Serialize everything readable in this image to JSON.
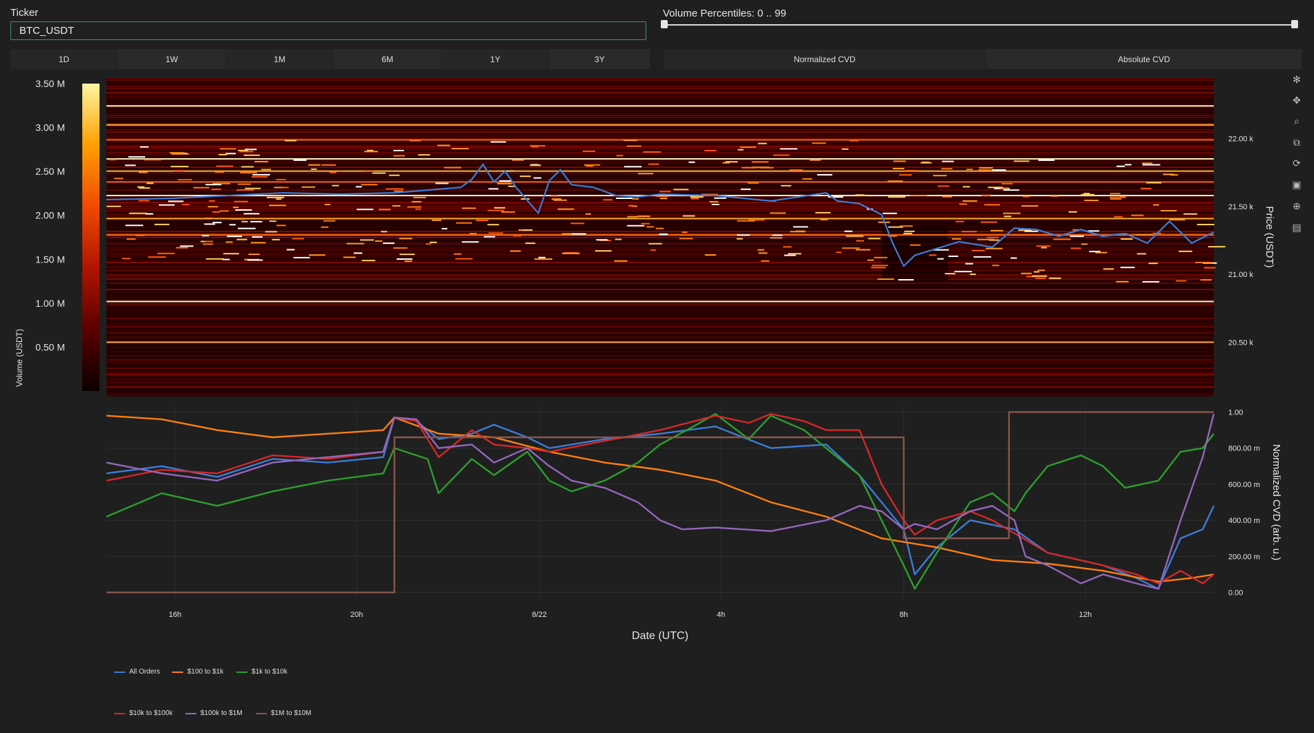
{
  "controls": {
    "ticker_label": "Ticker",
    "ticker_value": "BTC_USDT",
    "volume_percentiles_label": "Volume Percentiles: 0 .. 99",
    "volume_percentile_min": 0,
    "volume_percentile_max": 99,
    "timeframe_tabs": [
      "1D",
      "1W",
      "1M",
      "6M",
      "1Y",
      "3Y"
    ],
    "cvd_tabs": [
      "Normalized CVD",
      "Absolute CVD"
    ]
  },
  "modebar_icons": [
    "plotly-logo-icon",
    "pan-icon",
    "zoom-icon",
    "zoom-box-icon",
    "reset-icon",
    "save-icon",
    "crosshair-icon",
    "comment-icon"
  ],
  "chart_data": [
    {
      "type": "heatmap",
      "colorbar": {
        "title": "Volume (USDT)",
        "ticks": [
          "3.50 M",
          "3.00 M",
          "2.50 M",
          "2.00 M",
          "1.50 M",
          "1.00 M",
          "0.50 M"
        ],
        "tick_values": [
          3.5,
          3.0,
          2.5,
          2.0,
          1.5,
          1.0,
          0.5
        ],
        "range": [
          0,
          3.5
        ],
        "colorscale": [
          "#0a0000",
          "#5a0000",
          "#b01400",
          "#f04a00",
          "#ffa000",
          "#fff5a0"
        ]
      },
      "ylabel": "Price (USDT)",
      "y_ticks": [
        "22.00 k",
        "21.50 k",
        "21.00 k",
        "20.50 k"
      ],
      "y_tick_values": [
        22000,
        21500,
        21000,
        20500
      ],
      "ylim": [
        20100,
        22450
      ],
      "bright_levels": [
        22240,
        22100,
        21990,
        21850,
        21760,
        21680,
        21580,
        21410,
        21290,
        20800,
        20500
      ],
      "price_line": {
        "color": "#3b7dd8",
        "x": [
          0,
          6,
          11,
          16,
          21,
          26,
          32,
          33,
          34,
          35,
          36,
          37,
          39,
          40,
          41,
          42,
          44,
          46,
          48,
          50,
          55,
          60,
          65,
          66,
          68,
          70,
          71,
          72,
          73,
          75,
          77,
          80,
          82,
          84,
          86,
          88,
          90,
          92,
          94,
          96,
          98,
          100
        ],
        "y": [
          21550,
          21560,
          21580,
          21600,
          21590,
          21600,
          21640,
          21700,
          21810,
          21680,
          21760,
          21640,
          21450,
          21690,
          21770,
          21660,
          21640,
          21580,
          21570,
          21590,
          21580,
          21540,
          21600,
          21540,
          21520,
          21440,
          21230,
          21060,
          21140,
          21190,
          21240,
          21200,
          21340,
          21330,
          21280,
          21330,
          21280,
          21300,
          21230,
          21390,
          21230,
          21310
        ]
      },
      "x_ticks": [
        "16h",
        "20h",
        "8/22",
        "4h",
        "8h",
        "12h"
      ],
      "x_tick_positions": [
        6.2,
        22.6,
        39.1,
        55.5,
        72.0,
        88.4
      ]
    },
    {
      "type": "line",
      "xlabel": "Date (UTC)",
      "ylabel": "Normalized CVD (arb. u.)",
      "y_ticks": [
        "1.00",
        "800.00 m",
        "600.00 m",
        "400.00 m",
        "200.00 m",
        "0.00"
      ],
      "y_tick_values": [
        1.0,
        0.8,
        0.6,
        0.4,
        0.2,
        0.0
      ],
      "ylim": [
        -0.04,
        1.04
      ],
      "x_ticks": [
        "16h",
        "20h",
        "8/22",
        "4h",
        "8h",
        "12h"
      ],
      "x_tick_positions": [
        6.2,
        22.6,
        39.1,
        55.5,
        72.0,
        88.4
      ],
      "series": [
        {
          "name": "All Orders",
          "color": "#3b7dd8",
          "x": [
            0,
            5,
            10,
            15,
            20,
            25,
            26,
            28,
            30,
            33,
            35,
            38,
            40,
            45,
            50,
            55,
            60,
            65,
            68,
            70,
            72,
            73,
            75,
            78,
            82,
            85,
            90,
            93,
            95,
            97,
            99,
            100
          ],
          "y": [
            0.66,
            0.7,
            0.64,
            0.74,
            0.72,
            0.75,
            0.97,
            0.95,
            0.85,
            0.88,
            0.93,
            0.86,
            0.8,
            0.85,
            0.88,
            0.92,
            0.8,
            0.82,
            0.65,
            0.5,
            0.35,
            0.1,
            0.25,
            0.4,
            0.35,
            0.22,
            0.15,
            0.08,
            0.02,
            0.3,
            0.35,
            0.48
          ]
        },
        {
          "name": "$100 to $1k",
          "color": "#ff7f0e",
          "x": [
            0,
            5,
            10,
            15,
            20,
            25,
            26,
            30,
            35,
            40,
            45,
            50,
            55,
            60,
            65,
            70,
            75,
            80,
            85,
            90,
            95,
            98,
            100
          ],
          "y": [
            0.98,
            0.96,
            0.9,
            0.86,
            0.88,
            0.9,
            0.97,
            0.88,
            0.86,
            0.78,
            0.72,
            0.68,
            0.62,
            0.5,
            0.42,
            0.3,
            0.25,
            0.18,
            0.16,
            0.12,
            0.06,
            0.08,
            0.1
          ]
        },
        {
          "name": "$1k to $10k",
          "color": "#2ca02c",
          "x": [
            0,
            5,
            10,
            15,
            20,
            25,
            26,
            29,
            30,
            33,
            35,
            38,
            40,
            42,
            45,
            48,
            50,
            53,
            55,
            58,
            60,
            63,
            65,
            68,
            70,
            72,
            73,
            75,
            78,
            80,
            82,
            83,
            85,
            88,
            90,
            92,
            95,
            97,
            99,
            100
          ],
          "y": [
            0.42,
            0.55,
            0.48,
            0.56,
            0.62,
            0.66,
            0.8,
            0.74,
            0.55,
            0.74,
            0.65,
            0.78,
            0.62,
            0.56,
            0.62,
            0.72,
            0.82,
            0.92,
            0.99,
            0.85,
            0.98,
            0.9,
            0.8,
            0.65,
            0.4,
            0.15,
            0.02,
            0.22,
            0.5,
            0.55,
            0.45,
            0.55,
            0.7,
            0.76,
            0.7,
            0.58,
            0.62,
            0.78,
            0.8,
            0.88
          ]
        },
        {
          "name": "$10k to $100k",
          "color": "#d62728",
          "x": [
            0,
            5,
            10,
            15,
            20,
            25,
            26,
            28,
            30,
            33,
            35,
            38,
            40,
            45,
            50,
            55,
            58,
            60,
            63,
            65,
            68,
            70,
            72,
            73,
            75,
            78,
            80,
            85,
            90,
            93,
            95,
            97,
            99,
            100
          ],
          "y": [
            0.62,
            0.68,
            0.66,
            0.76,
            0.74,
            0.78,
            0.97,
            0.95,
            0.75,
            0.9,
            0.82,
            0.8,
            0.78,
            0.84,
            0.9,
            0.98,
            0.94,
            0.99,
            0.95,
            0.9,
            0.9,
            0.6,
            0.4,
            0.32,
            0.4,
            0.45,
            0.4,
            0.22,
            0.15,
            0.1,
            0.05,
            0.12,
            0.05,
            0.1
          ]
        },
        {
          "name": "$100k to $1M",
          "color": "#9467bd",
          "x": [
            0,
            5,
            10,
            15,
            20,
            25,
            26,
            28,
            30,
            33,
            35,
            38,
            40,
            42,
            45,
            48,
            50,
            52,
            55,
            60,
            65,
            68,
            70,
            72,
            73,
            75,
            78,
            80,
            82,
            83,
            85,
            88,
            90,
            93,
            95,
            97,
            99,
            100
          ],
          "y": [
            0.72,
            0.66,
            0.62,
            0.72,
            0.75,
            0.78,
            0.97,
            0.96,
            0.8,
            0.82,
            0.72,
            0.8,
            0.7,
            0.62,
            0.58,
            0.5,
            0.4,
            0.35,
            0.36,
            0.34,
            0.4,
            0.48,
            0.45,
            0.35,
            0.38,
            0.35,
            0.45,
            0.48,
            0.4,
            0.2,
            0.15,
            0.05,
            0.1,
            0.05,
            0.02,
            0.4,
            0.75,
            0.99
          ]
        },
        {
          "name": "$1M to $10M",
          "color": "#8c564b",
          "x": [
            0,
            26,
            26.01,
            72,
            72.01,
            81.5,
            81.51,
            100
          ],
          "y": [
            0.0,
            0.0,
            0.86,
            0.86,
            0.3,
            0.3,
            1.0,
            1.0
          ]
        }
      ]
    }
  ]
}
